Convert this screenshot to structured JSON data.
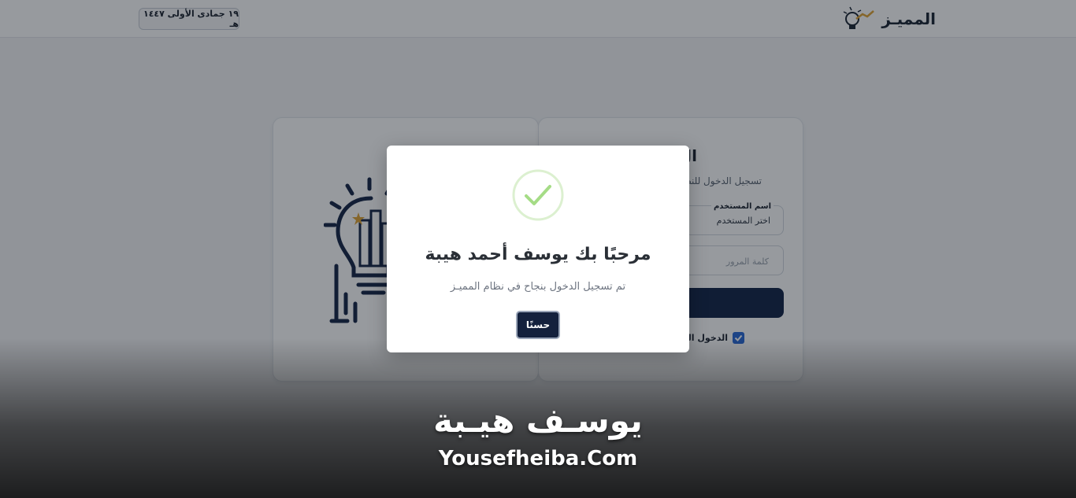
{
  "header": {
    "brand_name": "المميـز",
    "date": "١٩ جمادى الأولى ١٤٤٧ هـ"
  },
  "login": {
    "title": "ال",
    "subtitle": "تسجيل الدخول للنظ",
    "username": {
      "label": "اسم المستخدم",
      "value": "اختر المستخدم"
    },
    "password": {
      "placeholder": "كلمة المرور"
    },
    "remember_label": "الدخول التلق"
  },
  "modal": {
    "title": "مرحبًا بك يوسف أحمد هيبة",
    "text": "تم تسجيل الدخول بنجاح في نظام المميـز",
    "ok_label": "حسنًا",
    "icon": "check-circle-icon",
    "icon_color": "#a5dc86"
  },
  "watermark": {
    "arabic": "يوسـف هيـبة",
    "english": "Yousefheiba.Com"
  },
  "colors": {
    "primary": "#14213d",
    "accent_gold": "#e0a63a",
    "checkbox": "#2d6bd6"
  }
}
